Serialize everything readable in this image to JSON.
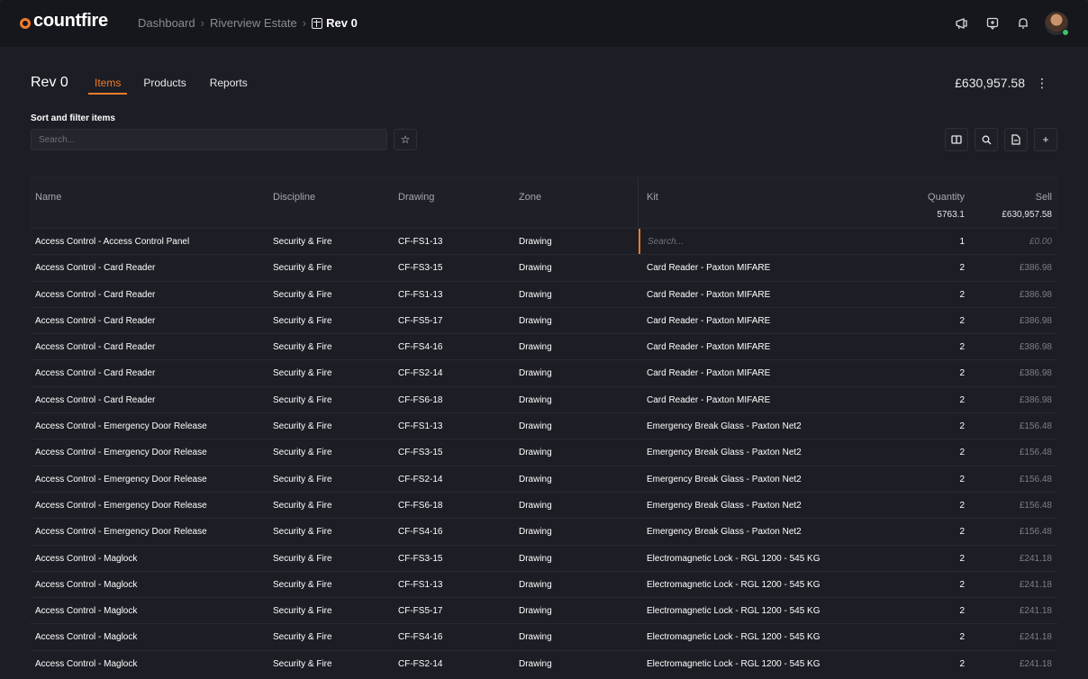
{
  "app": {
    "logo": "countfire"
  },
  "breadcrumb": {
    "items": [
      "Dashboard",
      "Riverview Estate"
    ],
    "current": "Rev 0",
    "separator": "›"
  },
  "topbar": {
    "icons": [
      "megaphone-icon",
      "feedback-icon",
      "bell-icon"
    ]
  },
  "header": {
    "title": "Rev 0",
    "tabs": [
      {
        "label": "Items",
        "active": true
      },
      {
        "label": "Products",
        "active": false
      },
      {
        "label": "Reports",
        "active": false
      }
    ],
    "total": "£630,957.58"
  },
  "filter": {
    "label": "Sort and filter items",
    "search_placeholder": "Search..."
  },
  "table": {
    "columns": {
      "name": "Name",
      "discipline": "Discipline",
      "drawing": "Drawing",
      "zone": "Zone",
      "kit": "Kit",
      "quantity": "Quantity",
      "sell": "Sell"
    },
    "totals": {
      "quantity": "5763.1",
      "sell": "£630,957.58"
    },
    "kit_search_placeholder": "Search...",
    "rows": [
      {
        "name": "Access Control - Access Control Panel",
        "discipline": "Security & Fire",
        "drawing": "CF-FS1-13",
        "zone": "Drawing",
        "kit": "",
        "quantity": "1",
        "sell": "£0.00"
      },
      {
        "name": "Access Control - Card Reader",
        "discipline": "Security & Fire",
        "drawing": "CF-FS3-15",
        "zone": "Drawing",
        "kit": "Card Reader - Paxton MIFARE",
        "quantity": "2",
        "sell": "£386.98"
      },
      {
        "name": "Access Control - Card Reader",
        "discipline": "Security & Fire",
        "drawing": "CF-FS1-13",
        "zone": "Drawing",
        "kit": "Card Reader - Paxton MIFARE",
        "quantity": "2",
        "sell": "£386.98"
      },
      {
        "name": "Access Control - Card Reader",
        "discipline": "Security & Fire",
        "drawing": "CF-FS5-17",
        "zone": "Drawing",
        "kit": "Card Reader - Paxton MIFARE",
        "quantity": "2",
        "sell": "£386.98"
      },
      {
        "name": "Access Control - Card Reader",
        "discipline": "Security & Fire",
        "drawing": "CF-FS4-16",
        "zone": "Drawing",
        "kit": "Card Reader - Paxton MIFARE",
        "quantity": "2",
        "sell": "£386.98"
      },
      {
        "name": "Access Control - Card Reader",
        "discipline": "Security & Fire",
        "drawing": "CF-FS2-14",
        "zone": "Drawing",
        "kit": "Card Reader - Paxton MIFARE",
        "quantity": "2",
        "sell": "£386.98"
      },
      {
        "name": "Access Control - Card Reader",
        "discipline": "Security & Fire",
        "drawing": "CF-FS6-18",
        "zone": "Drawing",
        "kit": "Card Reader - Paxton MIFARE",
        "quantity": "2",
        "sell": "£386.98"
      },
      {
        "name": "Access Control - Emergency Door Release",
        "discipline": "Security & Fire",
        "drawing": "CF-FS1-13",
        "zone": "Drawing",
        "kit": "Emergency Break Glass - Paxton Net2",
        "quantity": "2",
        "sell": "£156.48"
      },
      {
        "name": "Access Control - Emergency Door Release",
        "discipline": "Security & Fire",
        "drawing": "CF-FS3-15",
        "zone": "Drawing",
        "kit": "Emergency Break Glass - Paxton Net2",
        "quantity": "2",
        "sell": "£156.48"
      },
      {
        "name": "Access Control - Emergency Door Release",
        "discipline": "Security & Fire",
        "drawing": "CF-FS2-14",
        "zone": "Drawing",
        "kit": "Emergency Break Glass - Paxton Net2",
        "quantity": "2",
        "sell": "£156.48"
      },
      {
        "name": "Access Control - Emergency Door Release",
        "discipline": "Security & Fire",
        "drawing": "CF-FS6-18",
        "zone": "Drawing",
        "kit": "Emergency Break Glass - Paxton Net2",
        "quantity": "2",
        "sell": "£156.48"
      },
      {
        "name": "Access Control - Emergency Door Release",
        "discipline": "Security & Fire",
        "drawing": "CF-FS4-16",
        "zone": "Drawing",
        "kit": "Emergency Break Glass - Paxton Net2",
        "quantity": "2",
        "sell": "£156.48"
      },
      {
        "name": "Access Control - Maglock",
        "discipline": "Security & Fire",
        "drawing": "CF-FS3-15",
        "zone": "Drawing",
        "kit": "Electromagnetic Lock - RGL 1200 - 545 KG",
        "quantity": "2",
        "sell": "£241.18"
      },
      {
        "name": "Access Control - Maglock",
        "discipline": "Security & Fire",
        "drawing": "CF-FS1-13",
        "zone": "Drawing",
        "kit": "Electromagnetic Lock - RGL 1200 - 545 KG",
        "quantity": "2",
        "sell": "£241.18"
      },
      {
        "name": "Access Control - Maglock",
        "discipline": "Security & Fire",
        "drawing": "CF-FS5-17",
        "zone": "Drawing",
        "kit": "Electromagnetic Lock - RGL 1200 - 545 KG",
        "quantity": "2",
        "sell": "£241.18"
      },
      {
        "name": "Access Control - Maglock",
        "discipline": "Security & Fire",
        "drawing": "CF-FS4-16",
        "zone": "Drawing",
        "kit": "Electromagnetic Lock - RGL 1200 - 545 KG",
        "quantity": "2",
        "sell": "£241.18"
      },
      {
        "name": "Access Control - Maglock",
        "discipline": "Security & Fire",
        "drawing": "CF-FS2-14",
        "zone": "Drawing",
        "kit": "Electromagnetic Lock - RGL 1200 - 545 KG",
        "quantity": "2",
        "sell": "£241.18"
      }
    ]
  },
  "colors": {
    "accent": "#f07c2a",
    "background": "#1d1e25",
    "topbar": "#16171c",
    "status_online": "#3cc46b"
  }
}
